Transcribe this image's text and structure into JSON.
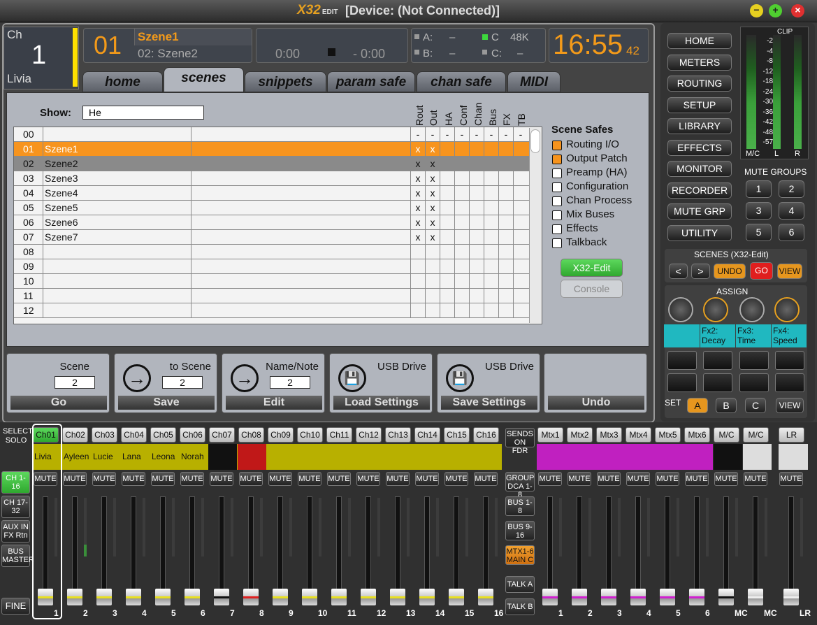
{
  "window": {
    "logo": "X32",
    "logo_sub": "EDIT",
    "title": "[Device: (Not Connected)]"
  },
  "channel": {
    "prefix": "Ch",
    "number": "1",
    "name": "Livia"
  },
  "scene": {
    "number": "01",
    "current": "Szene1",
    "next": "02: Szene2"
  },
  "transport": {
    "time1": "0:00",
    "time2": "- 0:00"
  },
  "status": {
    "a": "A:",
    "a_val": "–",
    "b": "B:",
    "b_val": "–",
    "c": "C",
    "c_val": "48K",
    "c2": "C:",
    "c2_val": "–"
  },
  "clock": {
    "time": "16:55",
    "seconds": "42"
  },
  "tabs": [
    "home",
    "scenes",
    "snippets",
    "param safe",
    "chan safe",
    "MIDI"
  ],
  "show": {
    "label": "Show:",
    "value": "He"
  },
  "columns": [
    "Rout",
    "Out",
    "HA",
    "Conf",
    "Chan",
    "Bus",
    "FX",
    "TB"
  ],
  "rows": [
    {
      "n": "00",
      "name": "",
      "rout": "-",
      "out": "-",
      "ha": "-",
      "conf": "-",
      "chan": "-",
      "bus": "-",
      "fx": "-",
      "tb": "-"
    },
    {
      "n": "01",
      "name": "Szene1",
      "rout": "x",
      "out": "x",
      "ha": "",
      "conf": "",
      "chan": "",
      "bus": "",
      "fx": "",
      "tb": ""
    },
    {
      "n": "02",
      "name": "Szene2",
      "rout": "x",
      "out": "x",
      "ha": "",
      "conf": "",
      "chan": "",
      "bus": "",
      "fx": "",
      "tb": ""
    },
    {
      "n": "03",
      "name": "Szene3",
      "rout": "x",
      "out": "x",
      "ha": "",
      "conf": "",
      "chan": "",
      "bus": "",
      "fx": "",
      "tb": ""
    },
    {
      "n": "04",
      "name": "Szene4",
      "rout": "x",
      "out": "x",
      "ha": "",
      "conf": "",
      "chan": "",
      "bus": "",
      "fx": "",
      "tb": ""
    },
    {
      "n": "05",
      "name": "Szene5",
      "rout": "x",
      "out": "x",
      "ha": "",
      "conf": "",
      "chan": "",
      "bus": "",
      "fx": "",
      "tb": ""
    },
    {
      "n": "06",
      "name": "Szene6",
      "rout": "x",
      "out": "x",
      "ha": "",
      "conf": "",
      "chan": "",
      "bus": "",
      "fx": "",
      "tb": ""
    },
    {
      "n": "07",
      "name": "Szene7",
      "rout": "x",
      "out": "x",
      "ha": "",
      "conf": "",
      "chan": "",
      "bus": "",
      "fx": "",
      "tb": ""
    },
    {
      "n": "08",
      "name": "",
      "rout": "",
      "out": "",
      "ha": "",
      "conf": "",
      "chan": "",
      "bus": "",
      "fx": "",
      "tb": ""
    },
    {
      "n": "09",
      "name": "",
      "rout": "",
      "out": "",
      "ha": "",
      "conf": "",
      "chan": "",
      "bus": "",
      "fx": "",
      "tb": ""
    },
    {
      "n": "10",
      "name": "",
      "rout": "",
      "out": "",
      "ha": "",
      "conf": "",
      "chan": "",
      "bus": "",
      "fx": "",
      "tb": ""
    },
    {
      "n": "11",
      "name": "",
      "rout": "",
      "out": "",
      "ha": "",
      "conf": "",
      "chan": "",
      "bus": "",
      "fx": "",
      "tb": ""
    },
    {
      "n": "12",
      "name": "",
      "rout": "",
      "out": "",
      "ha": "",
      "conf": "",
      "chan": "",
      "bus": "",
      "fx": "",
      "tb": ""
    }
  ],
  "safes": {
    "title": "Scene Safes",
    "items": [
      {
        "label": "Routing I/O",
        "checked": true
      },
      {
        "label": "Output Patch",
        "checked": true
      },
      {
        "label": "Preamp (HA)",
        "checked": false
      },
      {
        "label": "Configuration",
        "checked": false
      },
      {
        "label": "Chan Process",
        "checked": false
      },
      {
        "label": "Mix Buses",
        "checked": false
      },
      {
        "label": "Effects",
        "checked": false
      },
      {
        "label": "Talkback",
        "checked": false
      }
    ],
    "btn_edit": "X32-Edit",
    "btn_console": "Console"
  },
  "actions": {
    "go": {
      "label": "Scene",
      "value": "2",
      "button": "Go"
    },
    "save": {
      "label": "to Scene",
      "value": "2",
      "button": "Save"
    },
    "edit": {
      "label": "Name/Note",
      "value": "2",
      "button": "Edit"
    },
    "load": {
      "label": "USB Drive",
      "button": "Load Settings"
    },
    "savesettings": {
      "label": "USB Drive",
      "button": "Save Settings"
    },
    "undo": {
      "button": "Undo"
    }
  },
  "nav": [
    "HOME",
    "METERS",
    "ROUTING",
    "SETUP",
    "LIBRARY",
    "EFFECTS",
    "MONITOR",
    "RECORDER",
    "MUTE GRP",
    "UTILITY"
  ],
  "meter_labels": {
    "clip": "CLIP",
    "scale": [
      "-2",
      "-4",
      "-8",
      "-12",
      "-18",
      "-24",
      "-30",
      "-36",
      "-42",
      "-48",
      "-57"
    ],
    "mc": "M/C",
    "l": "L",
    "r": "R"
  },
  "mute_groups": {
    "title": "MUTE GROUPS",
    "buttons": [
      "1",
      "2",
      "3",
      "4",
      "5",
      "6"
    ]
  },
  "scenes_panel": {
    "title": "SCENES (X32-Edit)",
    "prev": "<",
    "next": ">",
    "undo": "UNDO",
    "go": "GO",
    "view": "VIEW"
  },
  "assign": {
    "title": "ASSIGN",
    "lcd": [
      "",
      "Fx2: Decay",
      "Fx3: Time",
      "Fx4: Speed"
    ],
    "set": "SET",
    "a": "A",
    "b": "B",
    "c": "C",
    "view": "VIEW"
  },
  "mixer_left": {
    "select": "SELECT",
    "solo": "SOLO",
    "ch116": "CH 1-16",
    "ch1732": "CH 17-32",
    "aux": "AUX IN FX Rtn",
    "bus": "BUS MASTER",
    "fine": "FINE"
  },
  "mixer_mid": {
    "sends": "SENDS ON FDR",
    "group": "GROUP DCA 1-8",
    "bus18": "BUS 1-8",
    "bus916": "BUS 9-16",
    "mtx": "MTX1-6 MAIN C",
    "talka": "TALK A",
    "talkb": "TALK B"
  },
  "strips": [
    {
      "id": "Ch01",
      "name": "Livia",
      "num": "1",
      "cap": "yellow",
      "sel": true
    },
    {
      "id": "Ch02",
      "name": "Ayleen",
      "num": "2",
      "cap": "yellow"
    },
    {
      "id": "Ch03",
      "name": "Lucie",
      "num": "3",
      "cap": "yellow"
    },
    {
      "id": "Ch04",
      "name": "Lana",
      "num": "4",
      "cap": "yellow"
    },
    {
      "id": "Ch05",
      "name": "Leona",
      "num": "5",
      "cap": "yellow"
    },
    {
      "id": "Ch06",
      "name": "Norah",
      "num": "6",
      "cap": "yellow"
    },
    {
      "id": "Ch07",
      "name": "",
      "num": "7",
      "cap": "black"
    },
    {
      "id": "Ch08",
      "name": "",
      "num": "8",
      "cap": "red"
    },
    {
      "id": "Ch09",
      "name": "",
      "num": "9",
      "cap": "yellow"
    },
    {
      "id": "Ch10",
      "name": "",
      "num": "10",
      "cap": "yellow"
    },
    {
      "id": "Ch11",
      "name": "",
      "num": "11",
      "cap": "yellow"
    },
    {
      "id": "Ch12",
      "name": "",
      "num": "12",
      "cap": "yellow"
    },
    {
      "id": "Ch13",
      "name": "",
      "num": "13",
      "cap": "yellow"
    },
    {
      "id": "Ch14",
      "name": "",
      "num": "14",
      "cap": "yellow"
    },
    {
      "id": "Ch15",
      "name": "",
      "num": "15",
      "cap": "yellow"
    },
    {
      "id": "Ch16",
      "name": "",
      "num": "16",
      "cap": "yellow"
    }
  ],
  "matrix": [
    {
      "id": "Mtx1",
      "num": "1"
    },
    {
      "id": "Mtx2",
      "num": "2"
    },
    {
      "id": "Mtx3",
      "num": "3"
    },
    {
      "id": "Mtx4",
      "num": "4"
    },
    {
      "id": "Mtx5",
      "num": "5"
    },
    {
      "id": "Mtx6",
      "num": "6"
    }
  ],
  "mc": {
    "id": "M/C",
    "num": "MC"
  },
  "lr": {
    "id": "LR",
    "num": "LR"
  },
  "mute_label": "MUTE",
  "colors": {
    "accent": "#f7941e",
    "scribble_yellow": "#b8b000",
    "scribble_magenta": "#c020c0",
    "green": "#3dc83d"
  }
}
